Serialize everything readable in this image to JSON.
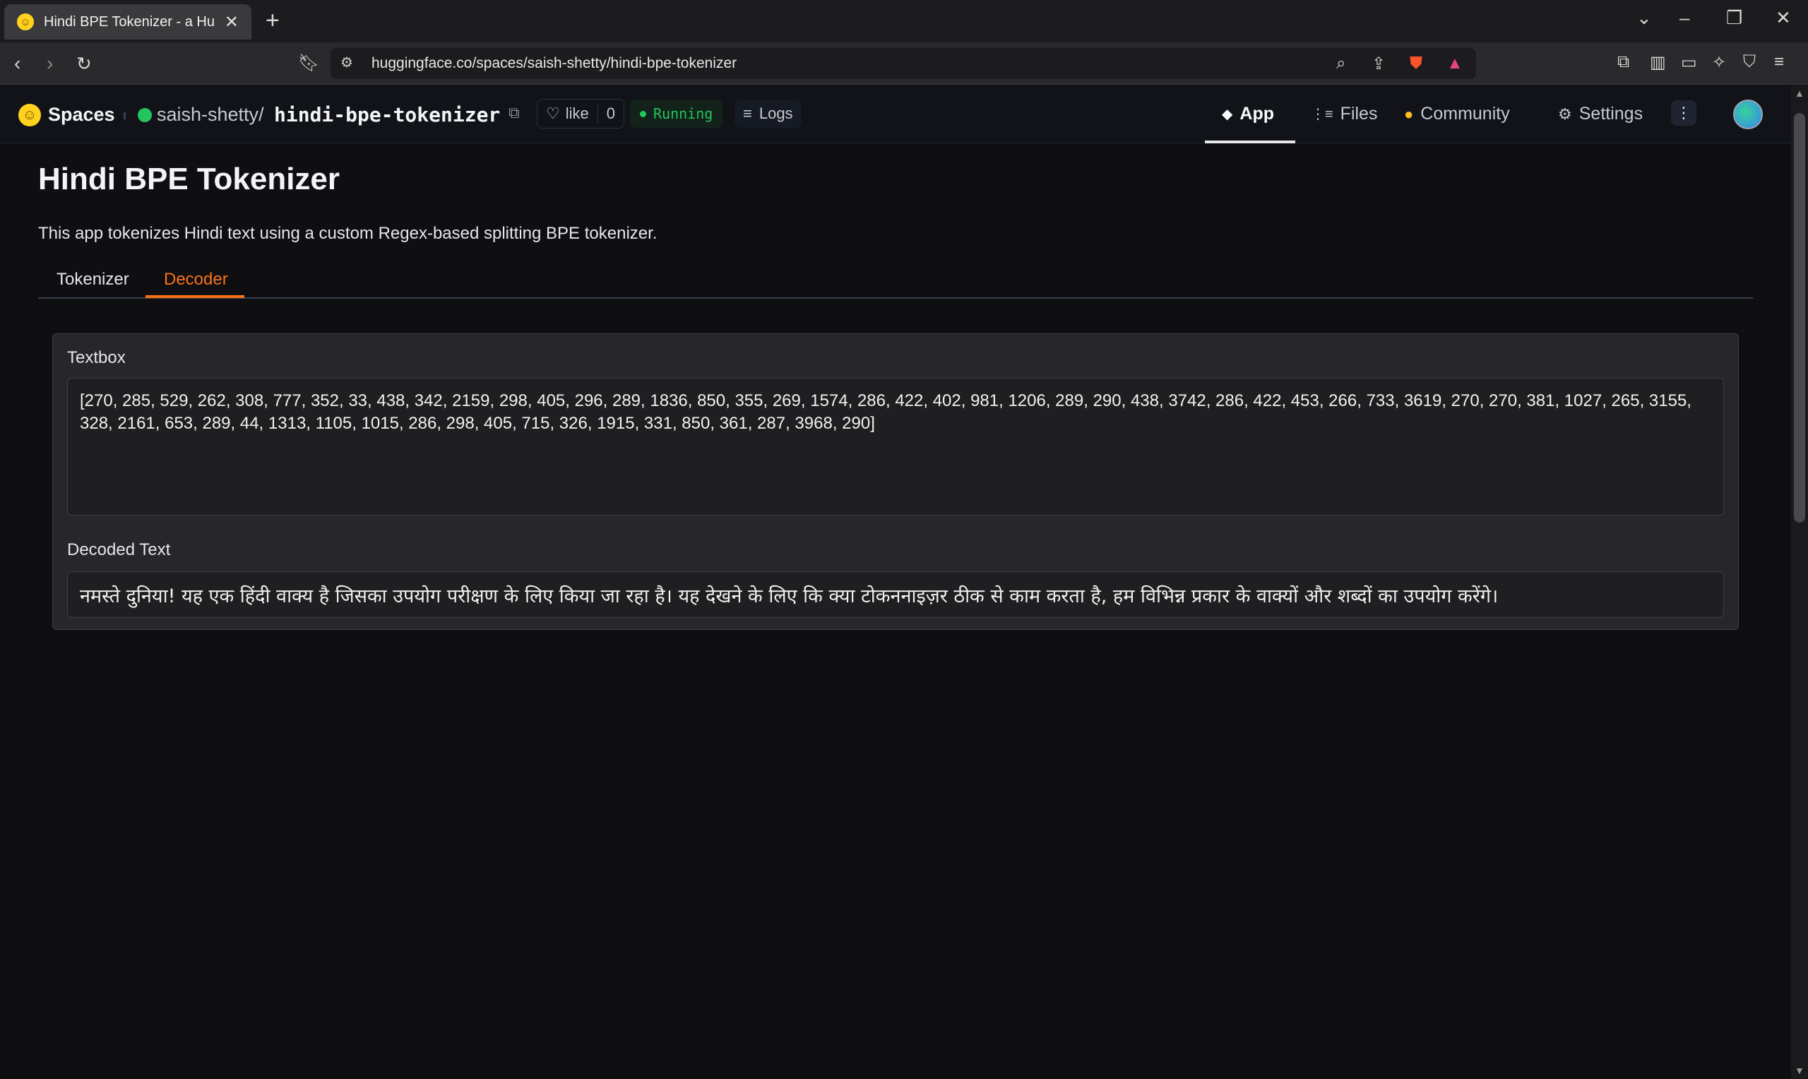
{
  "browser": {
    "tab_title": "Hindi BPE Tokenizer - a Huggin",
    "url": "huggingface.co/spaces/saish-shetty/hindi-bpe-tokenizer"
  },
  "header": {
    "spaces_label": "Spaces",
    "owner": "saish-shetty",
    "slash": "/",
    "repo": "hindi-bpe-tokenizer",
    "like_label": "like",
    "like_count": "0",
    "status": "Running",
    "logs_label": "Logs",
    "nav": {
      "app": "App",
      "files": "Files",
      "community": "Community",
      "settings": "Settings"
    }
  },
  "main": {
    "title": "Hindi BPE Tokenizer",
    "description": "This app tokenizes Hindi text using a custom Regex-based splitting BPE tokenizer.",
    "tabs": [
      {
        "label": "Tokenizer"
      },
      {
        "label": "Decoder"
      }
    ],
    "selected_tab": "Decoder",
    "textbox_label": "Textbox",
    "textbox_value": "[270, 285, 529, 262, 308, 777, 352, 33, 438, 342, 2159, 298, 405, 296, 289, 1836, 850, 355, 269, 1574, 286, 422, 402, 981, 1206, 289, 290, 438, 3742, 286, 422, 453, 266, 733, 3619, 270, 270, 381, 1027, 265, 3155, 328, 2161, 653, 289, 44, 1313, 1105, 1015, 286, 298, 405, 715, 326, 1915, 331, 850, 361, 287, 3968, 290]",
    "decoded_label": "Decoded Text",
    "decoded_value": "नमस्ते दुनिया! यह एक हिंदी वाक्य है जिसका उपयोग परीक्षण के लिए किया जा रहा है। यह देखने के लिए कि क्या टोकननाइज़र ठीक से काम करता है, हम विभिन्न प्रकार के वाक्यों और शब्दों का उपयोग करेंगे।"
  },
  "colors": {
    "accent": "#f97316",
    "running": "#22c55e",
    "background": "#0f0f11"
  }
}
